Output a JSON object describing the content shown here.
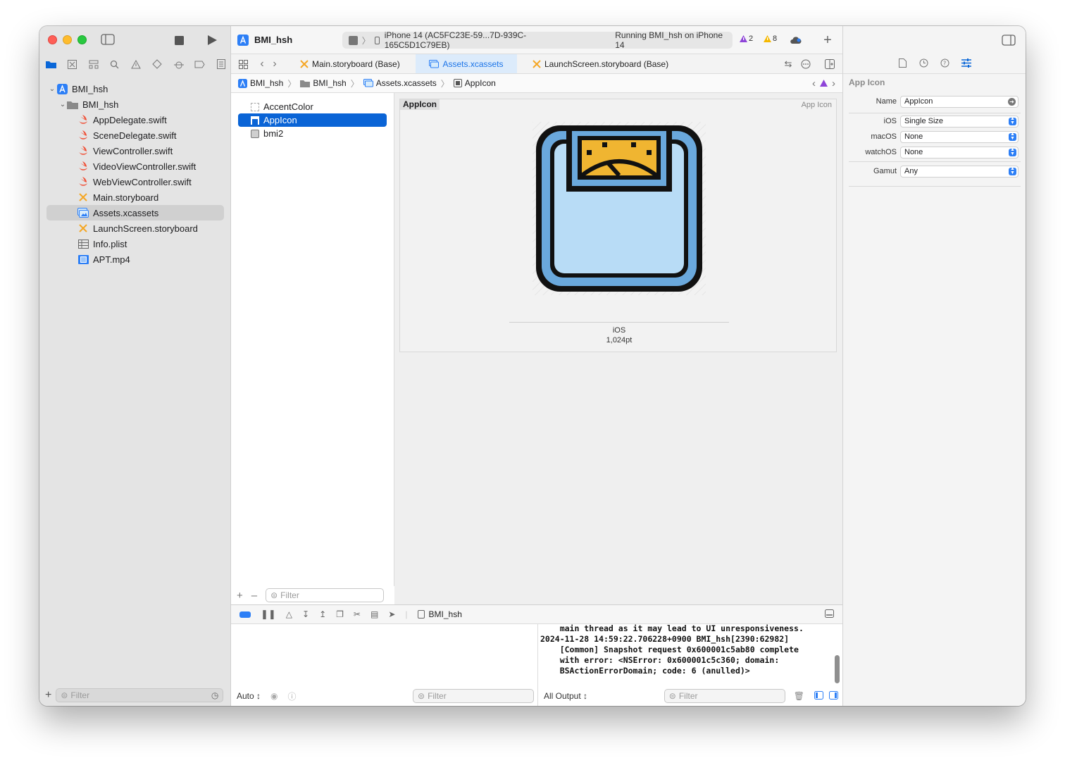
{
  "toolbar": {
    "project_title": "BMI_hsh",
    "scheme_target": "BMI_hsh",
    "device": "iPhone 14 (AC5FC23E-59...7D-939C-165C5D1C79EB)",
    "status": "Running BMI_hsh on iPhone 14",
    "warnings_purple": "2",
    "warnings_yellow": "8"
  },
  "navigator": {
    "items": [
      {
        "label": "BMI_hsh",
        "kind": "project"
      },
      {
        "label": "BMI_hsh",
        "kind": "folder"
      },
      {
        "label": "AppDelegate.swift",
        "kind": "swift"
      },
      {
        "label": "SceneDelegate.swift",
        "kind": "swift"
      },
      {
        "label": "ViewController.swift",
        "kind": "swift"
      },
      {
        "label": "VideoViewController.swift",
        "kind": "swift"
      },
      {
        "label": "WebViewController.swift",
        "kind": "swift"
      },
      {
        "label": "Main.storyboard",
        "kind": "storyboard"
      },
      {
        "label": "Assets.xcassets",
        "kind": "assets"
      },
      {
        "label": "LaunchScreen.storyboard",
        "kind": "storyboard"
      },
      {
        "label": "Info.plist",
        "kind": "plist"
      },
      {
        "label": "APT.mp4",
        "kind": "video"
      }
    ],
    "filter_placeholder": "Filter"
  },
  "editor_tabs": [
    {
      "label": "Main.storyboard (Base)"
    },
    {
      "label": "Assets.xcassets"
    },
    {
      "label": "LaunchScreen.storyboard (Base)"
    }
  ],
  "jumpbar": [
    "BMI_hsh",
    "BMI_hsh",
    "Assets.xcassets",
    "AppIcon"
  ],
  "asset_list": {
    "items": [
      "AccentColor",
      "AppIcon",
      "bmi2"
    ],
    "filter_placeholder": "Filter"
  },
  "detail": {
    "panel_title": "AppIcon",
    "panel_type": "App Icon",
    "platform": "iOS",
    "size": "1,024pt"
  },
  "debug": {
    "scheme": "BMI_hsh",
    "vars_mode": "Auto ↕",
    "vars_filter": "Filter",
    "output_mode": "All Output ↕",
    "console_filter": "Filter",
    "console_lines": [
      "    main thread as it may lead to UI unresponsiveness.",
      "2024-11-28 14:59:22.706228+0900 BMI_hsh[2390:62982]",
      "    [Common] Snapshot request 0x600001c5ab80 complete",
      "    with error: <NSError: 0x600001c5c360; domain:",
      "    BSActionErrorDomain; code: 6 (anulled)>"
    ]
  },
  "inspector": {
    "section": "App Icon",
    "name_label": "Name",
    "name_value": "AppIcon",
    "ios_label": "iOS",
    "ios_value": "Single Size",
    "macos_label": "macOS",
    "macos_value": "None",
    "watchos_label": "watchOS",
    "watchos_value": "None",
    "gamut_label": "Gamut",
    "gamut_value": "Any"
  },
  "colors": {
    "accent": "#0a64d6",
    "warning_purple": "#8e44d8",
    "warning_yellow": "#f5b800",
    "icon_frame": "#111111",
    "icon_blue": "#6aa8dc",
    "icon_light_blue": "#b8dcf6",
    "icon_gauge": "#f0b531"
  }
}
